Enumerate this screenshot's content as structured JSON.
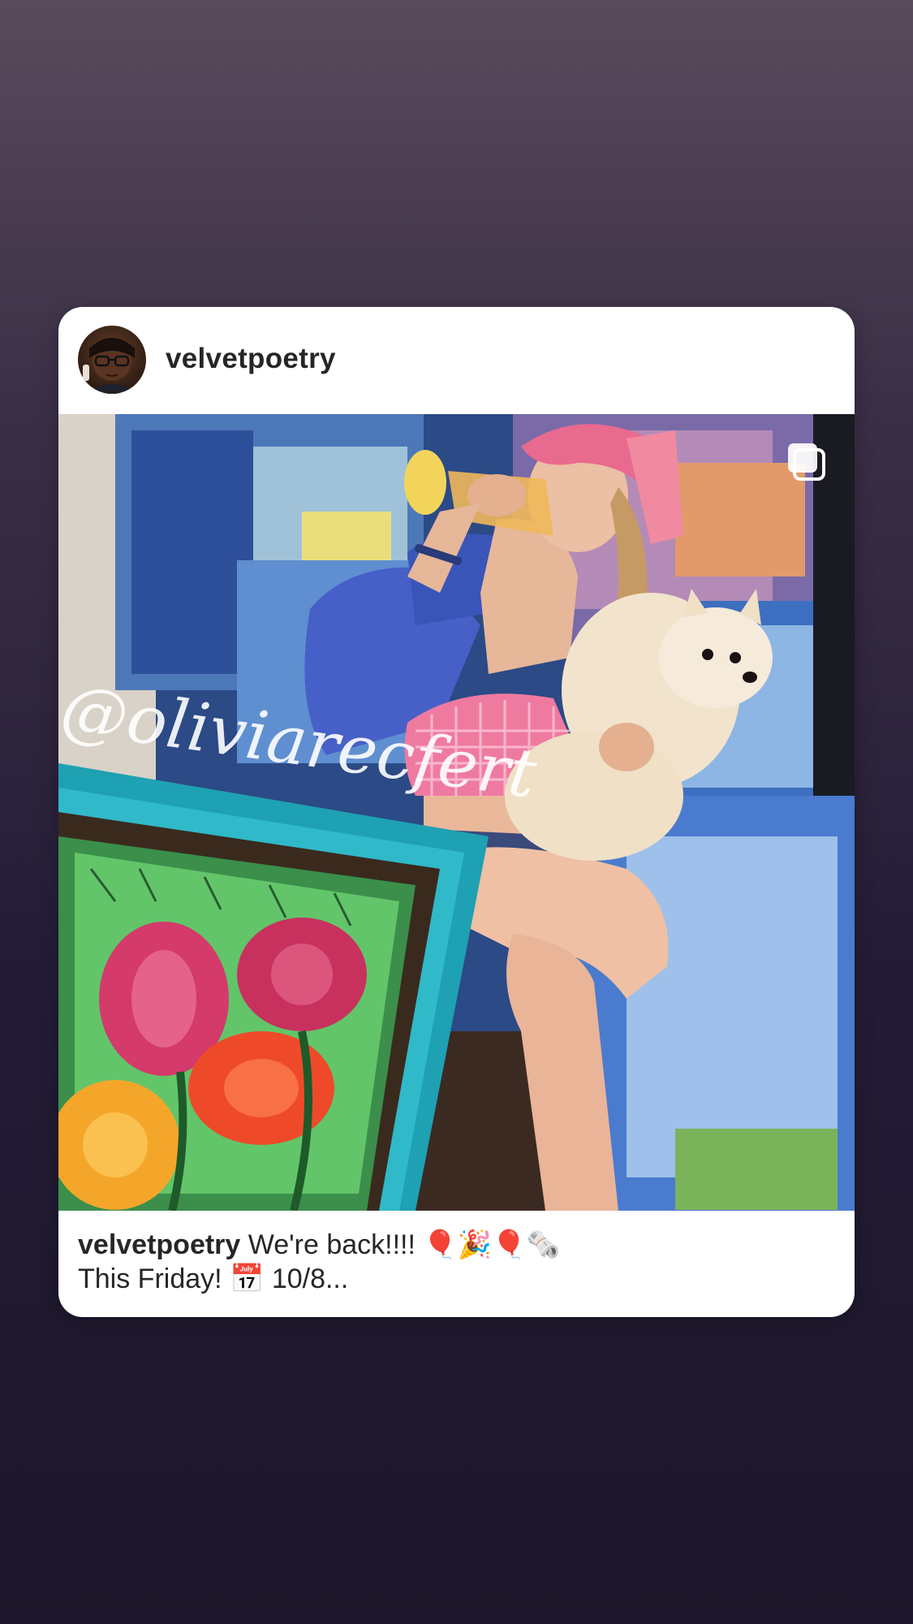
{
  "post": {
    "username": "velvetpoetry",
    "caption_username": "velvetpoetry",
    "caption_line1": "We're back!!!! 🎈🎉🎈🗞️",
    "caption_line2": "This Friday! 📅 10/8...",
    "watermark": "@oliviarecfert",
    "multi_image_icon": "carousel-icon"
  },
  "colors": {
    "card_background": "#ffffff",
    "text_primary": "#262626",
    "background_top": "#5a4a5c",
    "background_bottom": "#1b1629"
  }
}
